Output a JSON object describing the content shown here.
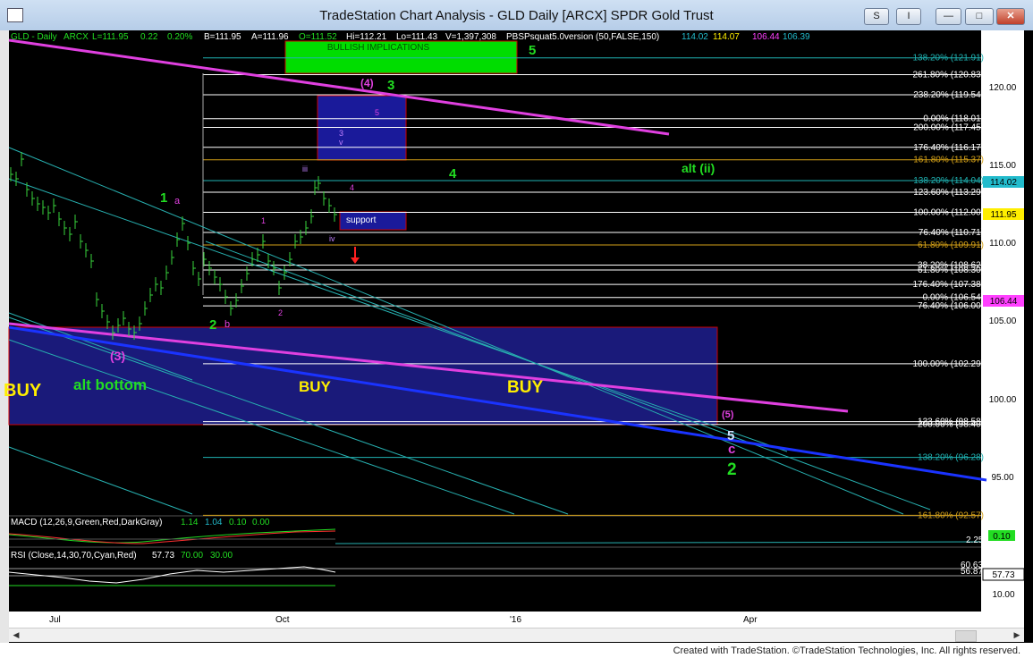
{
  "window": {
    "title": "TradeStation Chart Analysis - GLD Daily [ARCX] SPDR Gold Trust",
    "buttons": {
      "s": "S",
      "i": "I",
      "min": "—",
      "max": "□",
      "close": "✕"
    }
  },
  "header": {
    "symbol": "GLD - Daily",
    "exchange": "ARCX",
    "last": "L=111.95",
    "change": "0.22",
    "pct": "0.20%",
    "bid": "B=111.95",
    "ask": "A=111.96",
    "open": "O=111.52",
    "high": "Hi=112.21",
    "low": "Lo=111.43",
    "volume": "V=1,397,308",
    "study": "PBSPsquat5.0version (50,FALSE,150)",
    "v1": "114.02",
    "v2": "114.07",
    "v3": "106.44",
    "v4": "106.39"
  },
  "price_axis": {
    "ticks": [
      "120.00",
      "115.00",
      "110.00",
      "105.00",
      "100.00",
      "95.00"
    ],
    "badges": {
      "b114": "114.02",
      "b111": "111.95",
      "b106": "106.44"
    }
  },
  "time_axis": {
    "labels": [
      "Jul",
      "Oct",
      "'16",
      "Apr"
    ]
  },
  "fib_levels": [
    {
      "text": "138.20% (121.91)",
      "color": "#1fb3b3"
    },
    {
      "text": "261.80% (120.83)",
      "color": "#ffffff"
    },
    {
      "text": "238.20% (119.54)",
      "color": "#ffffff"
    },
    {
      "text": "0.00% (118.01)",
      "color": "#ffffff"
    },
    {
      "text": "200.00% (117.45)",
      "color": "#ffffff"
    },
    {
      "text": "176.40% (116.17)",
      "color": "#ffffff"
    },
    {
      "text": "161.80% (115.37)",
      "color": "#d4a017"
    },
    {
      "text": "138.20% (114.04)",
      "color": "#1fb3b3"
    },
    {
      "text": "123.60% (113.29)",
      "color": "#ffffff"
    },
    {
      "text": "100.00% (112.00)",
      "color": "#ffffff"
    },
    {
      "text": "76.40% (110.71)",
      "color": "#ffffff"
    },
    {
      "text": "61.80% (109.91)",
      "color": "#d4a017"
    },
    {
      "text": "38.20% (108.62)",
      "color": "#ffffff"
    },
    {
      "text": "61.80% (108.30)",
      "color": "#ffffff"
    },
    {
      "text": "176.40% (107.38)",
      "color": "#ffffff"
    },
    {
      "text": "0.00% (106.54)",
      "color": "#ffffff"
    },
    {
      "text": "76.40% (106.00)",
      "color": "#ffffff"
    },
    {
      "text": "100.00% (102.29)",
      "color": "#ffffff"
    },
    {
      "text": "123.60% (98.58)",
      "color": "#ffffff"
    },
    {
      "text": "200.00% (98.40)",
      "color": "#ffffff"
    },
    {
      "text": "138.20% (96.28)",
      "color": "#1fb3b3"
    },
    {
      "text": "161.80% (92.57)",
      "color": "#d4a017"
    }
  ],
  "boxes": {
    "bullish": "BULLISH IMPLICATIONS",
    "support": "support"
  },
  "labels": {
    "wave5_green": "5",
    "wave3_green": "3",
    "wave4_magenta_paren": "(4)",
    "wave5_magenta": "5",
    "wave3_purple": "3",
    "wave_v": "v",
    "wave_iii": "iii",
    "wave4_magenta": "4",
    "wave4_green": "4",
    "alt_ii": "alt (ii)",
    "wave1_green": "1",
    "wave_a": "a",
    "wave1_magenta": "1",
    "wave_iv": "iv",
    "wave2_green": "2",
    "wave_b": "b",
    "wave2_magenta": "2",
    "wave3_paren": "(3)",
    "buy_left": "BUY",
    "alt_bottom": "alt bottom",
    "buy_mid": "BUY",
    "buy_right": "BUY",
    "wave5_paren": "(5)",
    "wave5_white": "5",
    "wave_c": "c",
    "wave2_big": "2"
  },
  "macd": {
    "title": "MACD (12,26,9,Green,Red,DarkGray)",
    "v1": "1.14",
    "v2": "1.04",
    "v3": "0.10",
    "v4": "0.00",
    "right_label": "2.25",
    "badge": "0.10"
  },
  "rsi": {
    "title": "RSI (Close,14,30,70,Cyan,Red)",
    "v1": "57.73",
    "v2": "70.00",
    "v3": "30.00",
    "right_label": "56.87",
    "right_label2": "60.63",
    "badge": "57.73",
    "axis": "10.00"
  },
  "credit": "Created with TradeStation. ©TradeStation Technologies, Inc. All rights reserved."
}
